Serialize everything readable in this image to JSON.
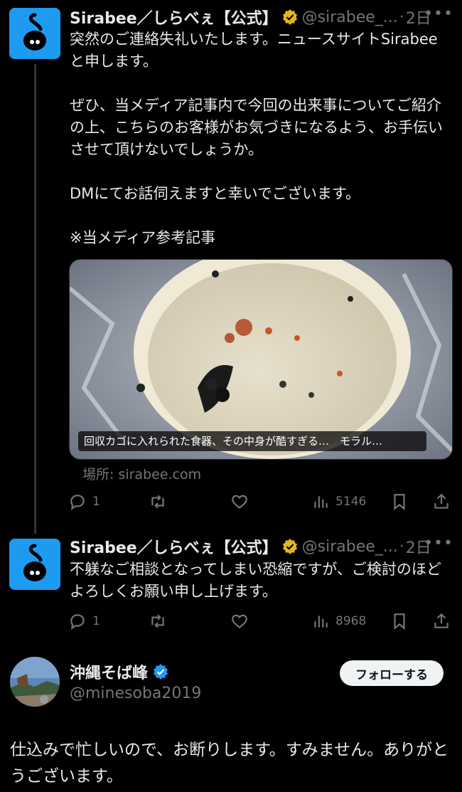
{
  "tweet1": {
    "name": "Sirabee／しらべぇ【公式】",
    "handle": "@sirabee_...",
    "dot": "·",
    "time": "2日",
    "more": "•••",
    "text": "突然のご連絡失礼いたします。ニュースサイトSirabeeと申します。\n\nぜひ、当メディア記事内で今回の出来事についてご紹介の上、こちらのお客様がお気づきになるよう、お手伝いさせて頂けないでしょうか。\n\nDMにてお話伺えますと幸いでございます。\n\n※当メディア参考記事",
    "card_caption": "回収カゴに入れられた食器、その中身が酷すぎる…　モラル…",
    "card_source": "場所: sirabee.com",
    "replies": "1",
    "views": "5146"
  },
  "tweet2": {
    "name": "Sirabee／しらべぇ【公式】",
    "handle": "@sirabee_...",
    "dot": "·",
    "time": "2日",
    "more": "•••",
    "text": "不躾なご相談となってしまい恐縮ですが、ご検討のほどよろしくお願い申し上げます。",
    "replies": "1",
    "views": "8968"
  },
  "reply": {
    "name": "沖縄そば峰",
    "handle": "@minesoba2019",
    "follow_label": "フォローする",
    "text": "仕込みで忙しいので、お断りします。すみません。ありがとうございます。"
  },
  "colors": {
    "background": "#000000",
    "text": "#e7e9ea",
    "muted": "#71767b",
    "verified_gold": "#e2b719",
    "verified_blue": "#1d9bf0",
    "avatar_blue": "#1d9bf0"
  },
  "icons": [
    "reply-icon",
    "retweet-icon",
    "like-icon",
    "views-icon",
    "bookmark-icon",
    "share-icon",
    "verified-gold-icon",
    "verified-blue-icon",
    "more-icon"
  ]
}
